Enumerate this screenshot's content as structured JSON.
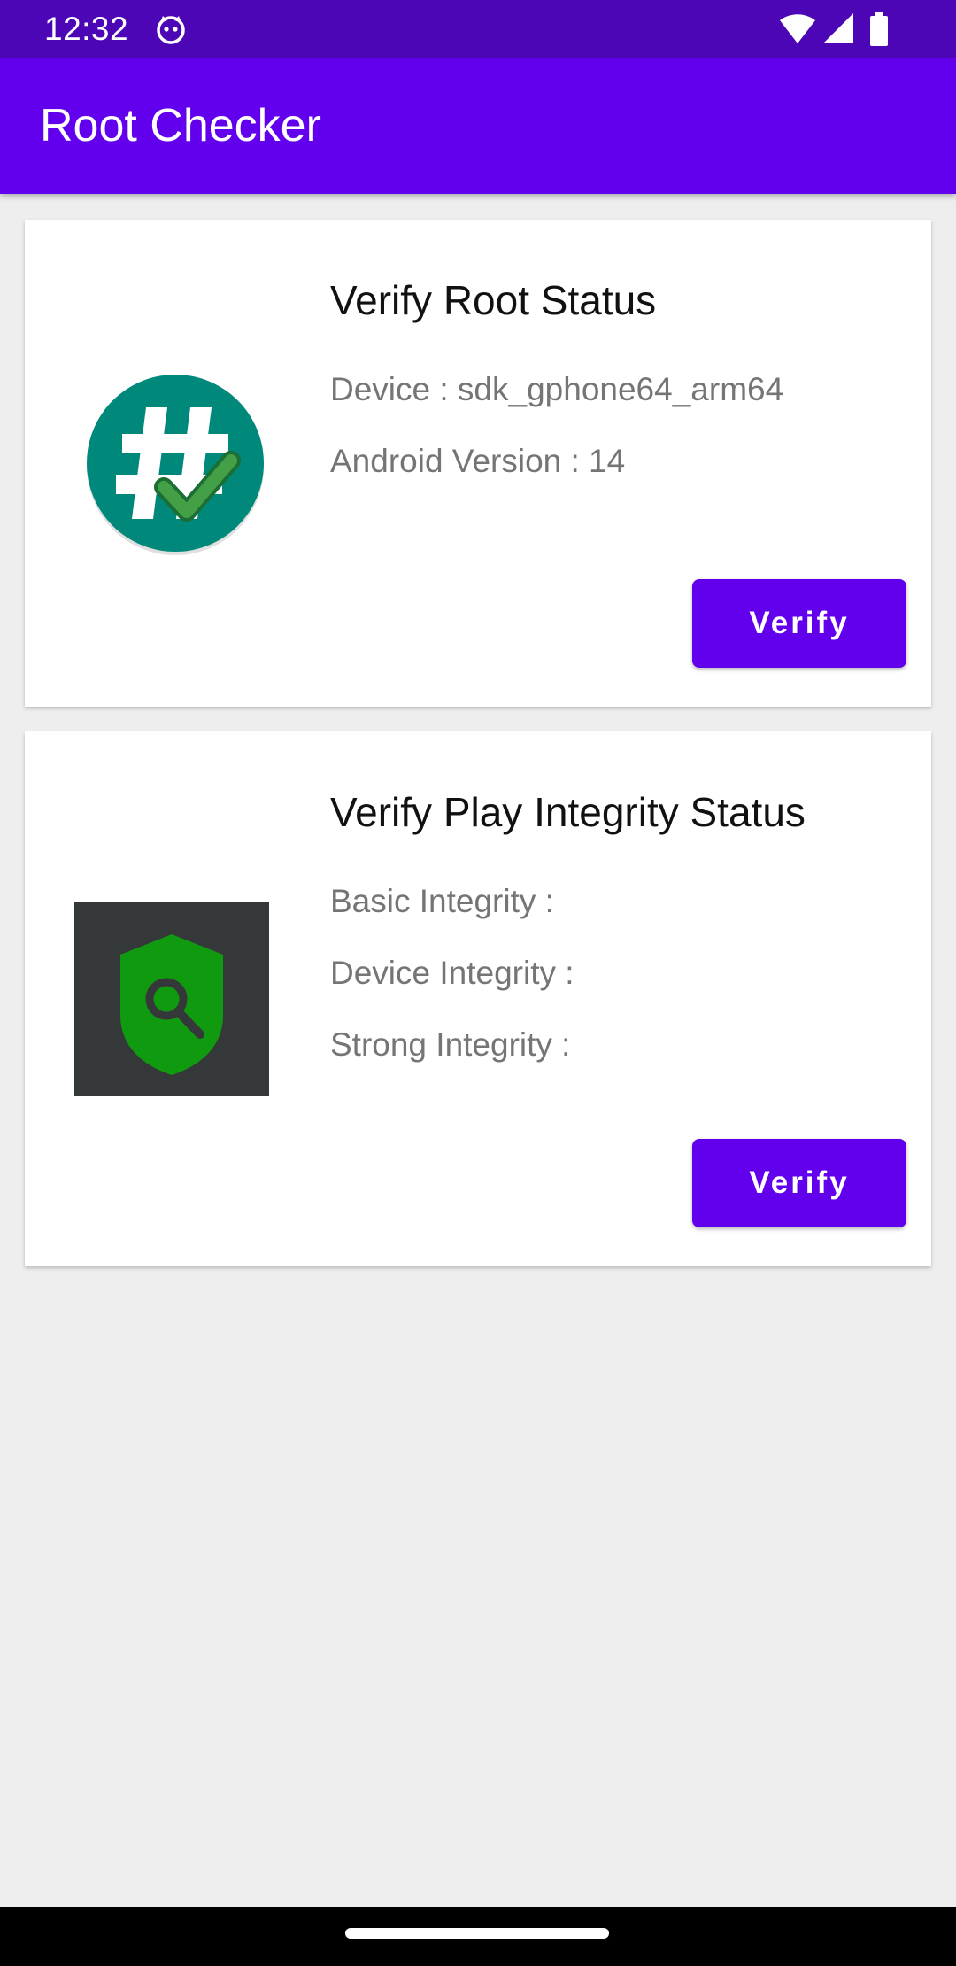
{
  "status_bar": {
    "time": "12:32",
    "icons": [
      "cat-notification-icon",
      "wifi-icon",
      "cellular-signal-icon",
      "battery-icon"
    ]
  },
  "app_bar": {
    "title": "Root Checker"
  },
  "root_card": {
    "icon": "root-hash-check-icon",
    "title": "Verify Root Status",
    "device_line": "Device : sdk_gphone64_arm64",
    "android_line": "Android Version : 14",
    "button_label": "Verify"
  },
  "integrity_card": {
    "icon": "shield-search-icon",
    "title": "Verify Play Integrity Status",
    "basic_line": "Basic Integrity :",
    "device_line": "Device Integrity :",
    "strong_line": "Strong Integrity :",
    "button_label": "Verify"
  },
  "colors": {
    "status_bar": "#4d06b6",
    "primary": "#6200ee",
    "background": "#eeeeee",
    "root_icon": "#00897b",
    "shield": "#109a10"
  }
}
